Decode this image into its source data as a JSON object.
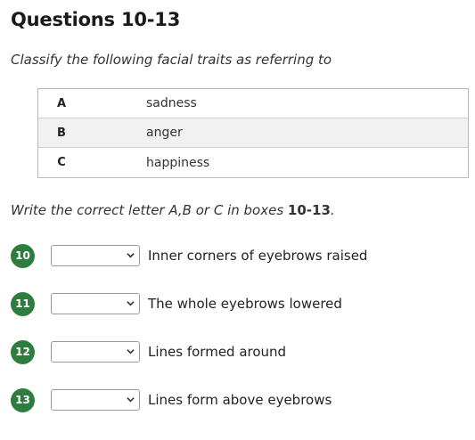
{
  "title": "Questions 10-13",
  "instruction": "Classify the following facial traits as referring to",
  "options": [
    {
      "letter": "A",
      "text": "sadness"
    },
    {
      "letter": "B",
      "text": "anger"
    },
    {
      "letter": "C",
      "text": "happiness"
    }
  ],
  "write_instruction": {
    "prefix": "Write the correct letter A,B or C in boxes ",
    "range": "10-13",
    "suffix": "."
  },
  "questions": [
    {
      "number": "10",
      "selected": "",
      "text": "Inner corners of eyebrows raised"
    },
    {
      "number": "11",
      "selected": "",
      "text": "The whole eyebrows lowered"
    },
    {
      "number": "12",
      "selected": "",
      "text": "Lines formed around"
    },
    {
      "number": "13",
      "selected": "",
      "text": "Lines form above eyebrows"
    }
  ],
  "icons": {
    "dropdown": "chevron-down-icon"
  },
  "colors": {
    "badge": "#2e7d3e",
    "table_shade": "#f1f1f1",
    "table_border": "#bbbbbb"
  }
}
